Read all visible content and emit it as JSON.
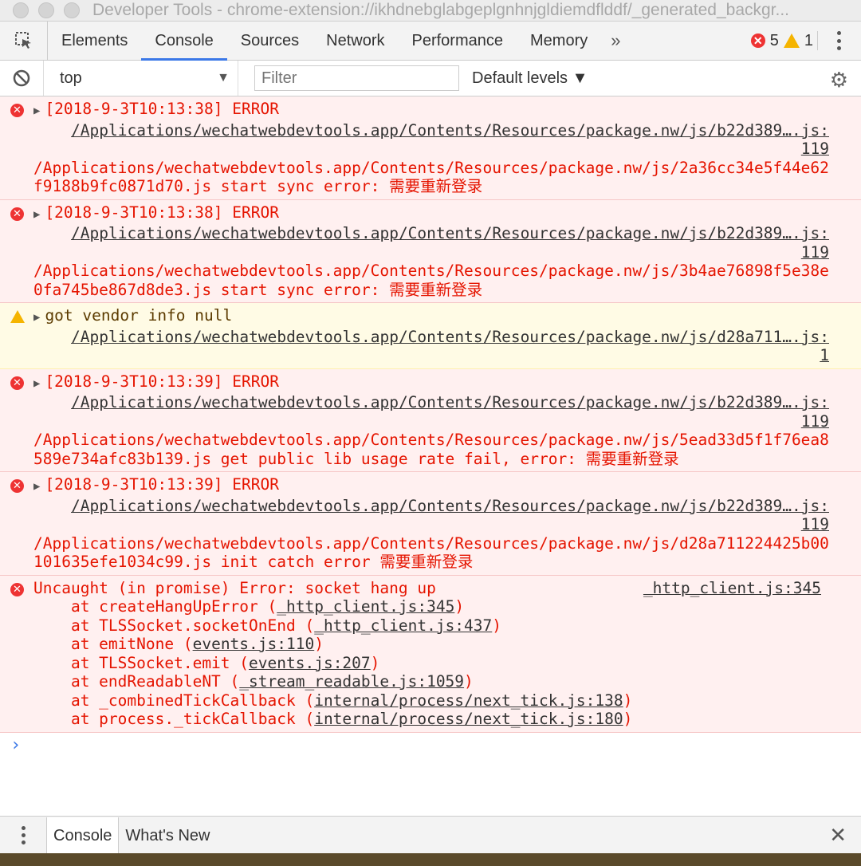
{
  "window": {
    "title": "Developer Tools - chrome-extension://ikhdnebglabgeplgnhnjgldiemdflddf/_generated_backgr..."
  },
  "tabs": [
    {
      "label": "Elements"
    },
    {
      "label": "Console"
    },
    {
      "label": "Sources"
    },
    {
      "label": "Network"
    },
    {
      "label": "Performance"
    },
    {
      "label": "Memory"
    }
  ],
  "tabs_more": "»",
  "counts": {
    "errors": "5",
    "warnings": "1"
  },
  "toolbar": {
    "context": "top",
    "filter_placeholder": "Filter",
    "levels": "Default levels ▼"
  },
  "messages": [
    {
      "head": "[2018-9-3T10:13:38] ERROR",
      "src": "/Applications/wechatwebdevtools.app/Contents/Resources/package.nw/js/b22d389….js:",
      "line": "119",
      "body": "/Applications/wechatwebdevtools.app/Contents/Resources/package.nw/js/2a36cc34e5f44e62f9188b9fc0871d70.js start sync error: 需要重新登录"
    },
    {
      "head": "[2018-9-3T10:13:38] ERROR",
      "src": "/Applications/wechatwebdevtools.app/Contents/Resources/package.nw/js/b22d389….js:",
      "line": "119",
      "body": "/Applications/wechatwebdevtools.app/Contents/Resources/package.nw/js/3b4ae76898f5e38e0fa745be867d8de3.js start sync error: 需要重新登录"
    },
    {
      "head": "got vendor info null",
      "src": "/Applications/wechatwebdevtools.app/Contents/Resources/package.nw/js/d28a711….js:",
      "line": "1",
      "body": ""
    },
    {
      "head": "[2018-9-3T10:13:39] ERROR",
      "src": "/Applications/wechatwebdevtools.app/Contents/Resources/package.nw/js/b22d389….js:",
      "line": "119",
      "body": "/Applications/wechatwebdevtools.app/Contents/Resources/package.nw/js/5ead33d5f1f76ea8589e734afc83b139.js get public lib usage rate fail, error: 需要重新登录"
    },
    {
      "head": "[2018-9-3T10:13:39] ERROR",
      "src": "/Applications/wechatwebdevtools.app/Contents/Resources/package.nw/js/b22d389….js:",
      "line": "119",
      "body": "/Applications/wechatwebdevtools.app/Contents/Resources/package.nw/js/d28a711224425b00101635efe1034c99.js init catch error 需要重新登录"
    }
  ],
  "uncaught": {
    "head": "Uncaught (in promise) Error: socket hang up",
    "src": "_http_client.js:345",
    "stack": [
      {
        "fn": "    at createHangUpError (",
        "loc": "_http_client.js:345",
        "end": ")"
      },
      {
        "fn": "    at TLSSocket.socketOnEnd (",
        "loc": "_http_client.js:437",
        "end": ")"
      },
      {
        "fn": "    at emitNone (",
        "loc": "events.js:110",
        "end": ")"
      },
      {
        "fn": "    at TLSSocket.emit (",
        "loc": "events.js:207",
        "end": ")"
      },
      {
        "fn": "    at endReadableNT (",
        "loc": "_stream_readable.js:1059",
        "end": ")"
      },
      {
        "fn": "    at _combinedTickCallback (",
        "loc": "internal/process/next_tick.js:138",
        "end": ")"
      },
      {
        "fn": "    at process._tickCallback (",
        "loc": "internal/process/next_tick.js:180",
        "end": ")"
      }
    ]
  },
  "prompt": "›",
  "drawer": {
    "tabs": [
      {
        "label": "Console"
      },
      {
        "label": "What's New"
      }
    ],
    "close": "✕"
  },
  "icons": {
    "error_color": "#e33333",
    "warning_color": "#f5b400",
    "accent": "#3b78e7"
  }
}
